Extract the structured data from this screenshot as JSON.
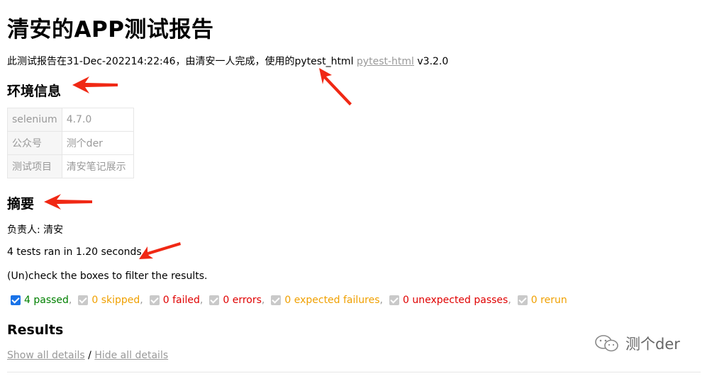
{
  "report": {
    "title": "清安的APP测试报告",
    "intro_text": "此测试报告在31-Dec-202214:22:46，由清安一人完成，使用的pytest_html ",
    "intro_link": "pytest-html",
    "intro_version": " v3.2.0"
  },
  "environment": {
    "heading": "环境信息",
    "rows": [
      {
        "key": "selenium",
        "value": "4.7.0"
      },
      {
        "key": "公众号",
        "value": "测个der"
      },
      {
        "key": "测试项目",
        "value": "清安笔记展示"
      }
    ]
  },
  "summary": {
    "heading": "摘要",
    "owner": "负责人: 清安",
    "ran": "4 tests ran in 1.20 seconds.",
    "hint": "(Un)check the boxes to filter the results."
  },
  "filters": [
    {
      "label": "4 passed",
      "checked": true,
      "color": "#008000"
    },
    {
      "label": "0 skipped",
      "checked": false,
      "color": "#f0a000"
    },
    {
      "label": "0 failed",
      "checked": false,
      "color": "#e00000"
    },
    {
      "label": "0 errors",
      "checked": false,
      "color": "#e00000"
    },
    {
      "label": "0 expected failures",
      "checked": false,
      "color": "#f0a000"
    },
    {
      "label": "0 unexpected passes",
      "checked": false,
      "color": "#e00000"
    },
    {
      "label": "0 rerun",
      "checked": false,
      "color": "#f0a000"
    }
  ],
  "results": {
    "heading": "Results",
    "show_all": "Show all details",
    "separator": " / ",
    "hide_all": "Hide all details"
  },
  "watermark": {
    "text": "测个der",
    "icon": "wechat-icon"
  },
  "colors": {
    "arrow": "#f02814",
    "link": "#999999"
  }
}
